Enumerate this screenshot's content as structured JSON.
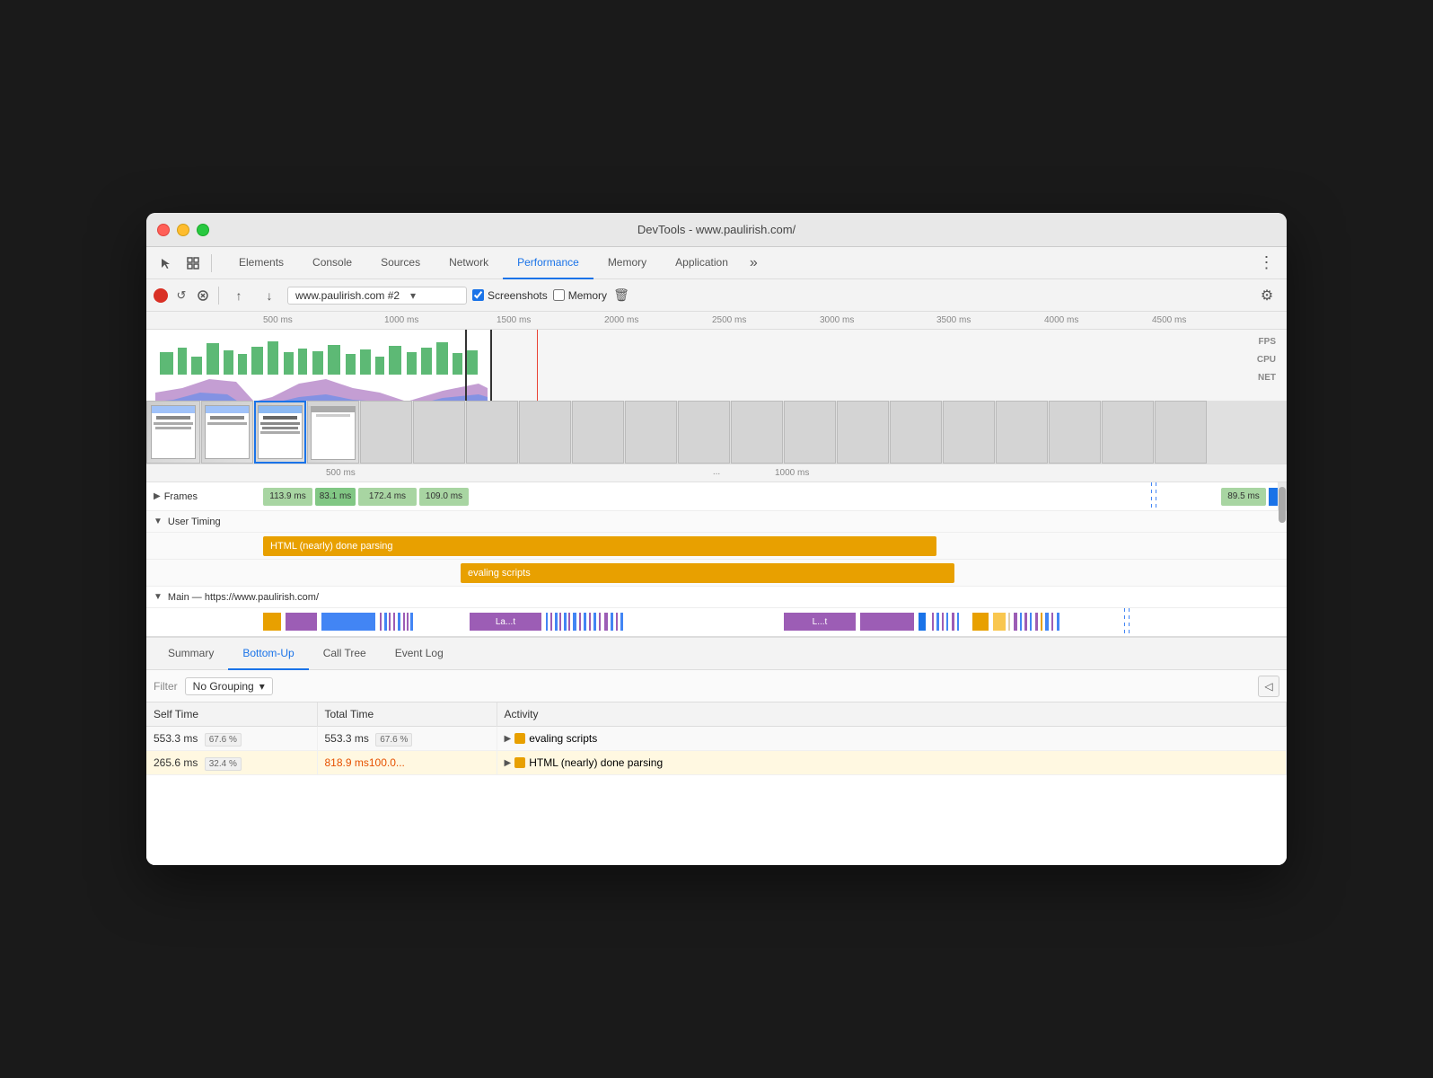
{
  "window": {
    "title": "DevTools - www.paulirish.com/"
  },
  "devtools_tabs": {
    "items": [
      {
        "label": "Elements",
        "active": false
      },
      {
        "label": "Console",
        "active": false
      },
      {
        "label": "Sources",
        "active": false
      },
      {
        "label": "Network",
        "active": false
      },
      {
        "label": "Performance",
        "active": true
      },
      {
        "label": "Memory",
        "active": false
      },
      {
        "label": "Application",
        "active": false
      }
    ],
    "more_label": "»"
  },
  "recording_bar": {
    "url_label": "www.paulirish.com #2",
    "screenshots_label": "Screenshots",
    "memory_label": "Memory"
  },
  "timeline_ruler": {
    "marks": [
      "500 ms",
      "1000 ms",
      "1500 ms",
      "2000 ms",
      "2500 ms",
      "3000 ms",
      "3500 ms",
      "4000 ms",
      "4500 ms"
    ]
  },
  "right_labels": {
    "fps": "FPS",
    "cpu": "CPU",
    "net": "NET"
  },
  "flame_chart": {
    "ruler_marks": [
      "500 ms",
      "1000 ms"
    ],
    "dotdot": "...",
    "rows": {
      "frames": {
        "label": "Frames",
        "blocks": [
          {
            "time": "113.9 ms",
            "color": "green"
          },
          {
            "time": "83.1 ms",
            "color": "green",
            "highlight": true
          },
          {
            "time": "172.4 ms",
            "color": "green"
          },
          {
            "time": "109.0 ms",
            "color": "green"
          },
          {
            "time": "89.5 ms",
            "color": "green"
          }
        ]
      },
      "user_timing": {
        "label": "User Timing",
        "bars": [
          {
            "text": "HTML (nearly) done parsing",
            "color": "orange"
          },
          {
            "text": "evaling scripts",
            "color": "orange"
          }
        ]
      },
      "main": {
        "label": "Main — https://www.paulirish.com/",
        "bars": [
          {
            "text": "La...t",
            "color": "purple"
          },
          {
            "text": "L...t",
            "color": "purple"
          }
        ]
      }
    }
  },
  "bottom_tabs": [
    "Summary",
    "Bottom-Up",
    "Call Tree",
    "Event Log"
  ],
  "active_bottom_tab": "Bottom-Up",
  "filter": {
    "label": "Filter",
    "grouping_label": "No Grouping"
  },
  "table": {
    "headers": [
      "Self Time",
      "Total Time",
      "Activity"
    ],
    "rows": [
      {
        "self_time": "553.3 ms",
        "self_pct": "67.6 %",
        "total_time": "553.3 ms",
        "total_pct": "67.6 %",
        "activity": "evaling scripts",
        "icon_color": "orange",
        "highlight": false
      },
      {
        "self_time": "265.6 ms",
        "self_pct": "32.4 %",
        "total_time": "818.9 ms100.0...",
        "total_pct": "",
        "activity": "HTML (nearly) done parsing",
        "icon_color": "orange",
        "highlight": true
      }
    ]
  }
}
